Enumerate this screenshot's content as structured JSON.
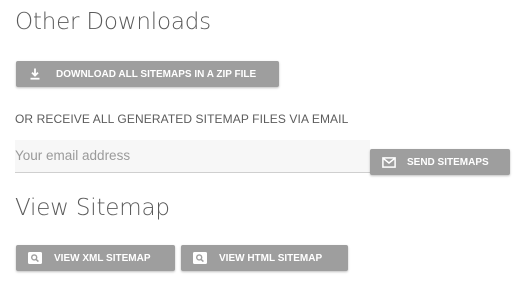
{
  "downloads": {
    "title": "Other Downloads",
    "zip_button_label": "DOWNLOAD ALL SITEMAPS IN A ZIP FILE",
    "zip_button_icon": "download-icon",
    "email_note": "OR RECEIVE ALL GENERATED SITEMAP FILES VIA EMAIL",
    "email_placeholder": "Your email address",
    "email_value": "",
    "send_button_label": "SEND SITEMAPS",
    "send_button_icon": "mail-icon"
  },
  "view": {
    "title": "View Sitemap",
    "xml_button_label": "VIEW XML SITEMAP",
    "html_button_label": "VIEW HTML SITEMAP",
    "button_icon": "search-icon"
  },
  "colors": {
    "button_bg": "#9e9e9e",
    "button_text": "#ffffff",
    "heading_text": "#5a5a5a",
    "input_bg": "#f7f7f7"
  }
}
